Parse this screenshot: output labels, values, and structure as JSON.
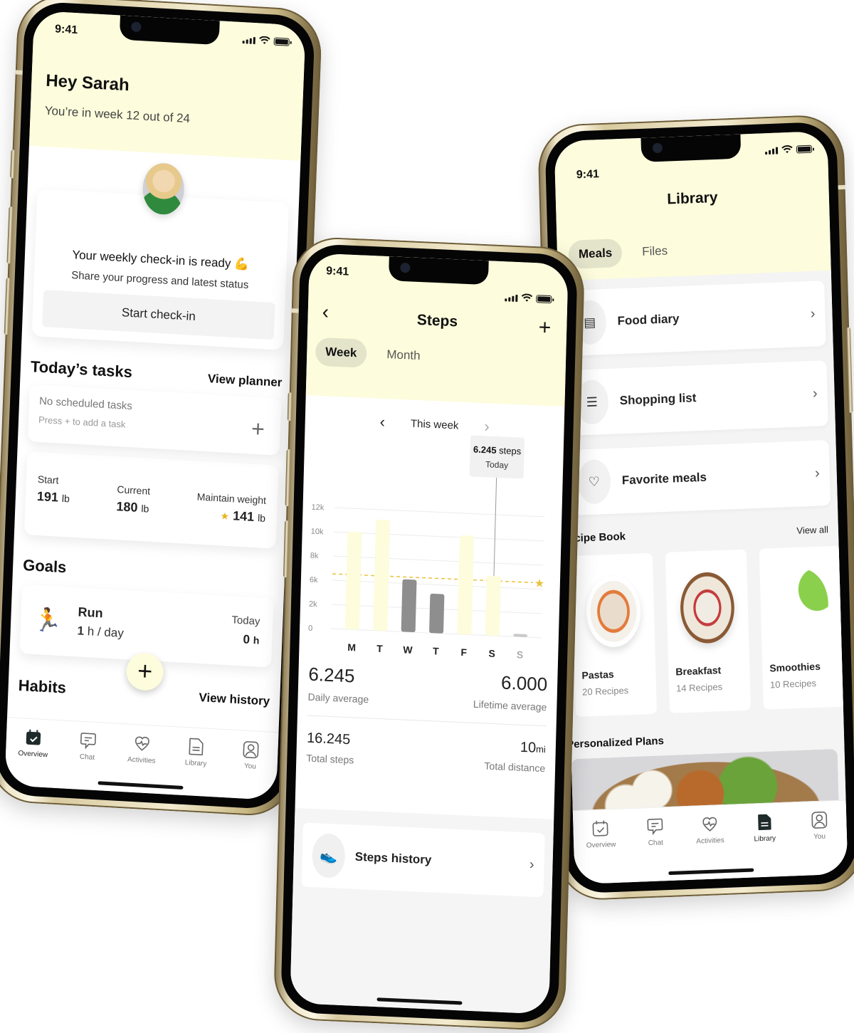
{
  "status_bar": {
    "time": "9:41"
  },
  "overview": {
    "greeting": "Hey Sarah",
    "week_progress": "You’re in week 12 out of 24",
    "checkin": {
      "title": "Your weekly check-in is ready 💪",
      "subtitle": "Share your progress and latest status",
      "button": "Start check-in"
    },
    "tasks": {
      "title": "Today’s tasks",
      "link": "View planner",
      "empty": "No scheduled tasks",
      "hint": "Press + to add a task",
      "add_icon": "+"
    },
    "weight": {
      "start_label": "Start",
      "start_value": "191",
      "start_unit": "lb",
      "current_label": "Current",
      "current_value": "180",
      "current_unit": "lb",
      "goal_label": "Maintain weight",
      "goal_value": "141",
      "goal_unit": "lb",
      "goal_icon": "★"
    },
    "goals": {
      "title": "Goals",
      "items": [
        {
          "icon": "🏃",
          "name": "Run",
          "target_value": "1",
          "target_unit": "h / day",
          "today_label": "Today",
          "today_value": "0",
          "today_unit": "h"
        }
      ]
    },
    "fab": "+",
    "habits": {
      "title": "Habits",
      "link": "View history"
    }
  },
  "tabbar": {
    "items": [
      {
        "label": "Overview",
        "icon": "calendar-check-icon"
      },
      {
        "label": "Chat",
        "icon": "chat-icon"
      },
      {
        "label": "Activities",
        "icon": "heart-pulse-icon"
      },
      {
        "label": "Library",
        "icon": "document-icon"
      },
      {
        "label": "You",
        "icon": "user-icon"
      }
    ],
    "active_phone1": "Overview",
    "active_phone3": "Library"
  },
  "steps": {
    "back": "‹",
    "title": "Steps",
    "add": "+",
    "tabs": [
      "Week",
      "Month"
    ],
    "active_tab": "Week",
    "period": {
      "prev": "‹",
      "label": "This week",
      "next": "›"
    },
    "tooltip": {
      "value": "6.245",
      "unit": "steps",
      "label": "Today"
    },
    "stats": [
      {
        "value": "6.245",
        "label": "Daily average"
      },
      {
        "value": "6.000",
        "label": "Lifetime average"
      },
      {
        "value": "16.245",
        "label": "Total steps"
      },
      {
        "value": "10",
        "unit": "mi",
        "label": "Total distance"
      }
    ],
    "history": {
      "label": "Steps history",
      "icon": "shoe-icon",
      "chevron": "›"
    }
  },
  "chart_data": {
    "type": "bar",
    "title": "Steps",
    "categories": [
      "M",
      "T",
      "W",
      "T",
      "F",
      "S",
      "S"
    ],
    "values": [
      9700,
      11000,
      5200,
      3900,
      9800,
      5900,
      200
    ],
    "highlighted": [
      true,
      true,
      false,
      false,
      true,
      true,
      false
    ],
    "y_tick_labels": [
      "0",
      "2k",
      "6k",
      "8k",
      "10k",
      "12k"
    ],
    "ylim": [
      0,
      12000
    ],
    "goal_line": 6000,
    "goal_marker": "★",
    "selected_index": 5,
    "grid": true,
    "xlabel": "",
    "ylabel": "",
    "colors": {
      "met": "#fdfcdc",
      "missed": "#8e8e8e",
      "future": "#c9c9c9",
      "goal": "#e8c23a"
    }
  },
  "library": {
    "title": "Library",
    "tabs": [
      "Meals",
      "Files"
    ],
    "active_tab": "Meals",
    "items": [
      {
        "label": "Food diary",
        "icon": "diary-icon"
      },
      {
        "label": "Shopping list",
        "icon": "receipt-icon"
      },
      {
        "label": "Favorite meals",
        "icon": "bowl-heart-icon"
      }
    ],
    "chevron": "›",
    "recipe_book": {
      "title": "Recipe Book",
      "link": "View all",
      "cards": [
        {
          "name": "Pastas",
          "count": "20 Recipes"
        },
        {
          "name": "Breakfast",
          "count": "14 Recipes"
        },
        {
          "name": "Smoothies",
          "count": "10 Recipes"
        }
      ]
    },
    "plans_title": "Personalized Plans"
  },
  "colors": {
    "header_bg": "#fdfcdc",
    "pill_active": "#e4e4cb",
    "accent_star": "#e8b31b"
  }
}
